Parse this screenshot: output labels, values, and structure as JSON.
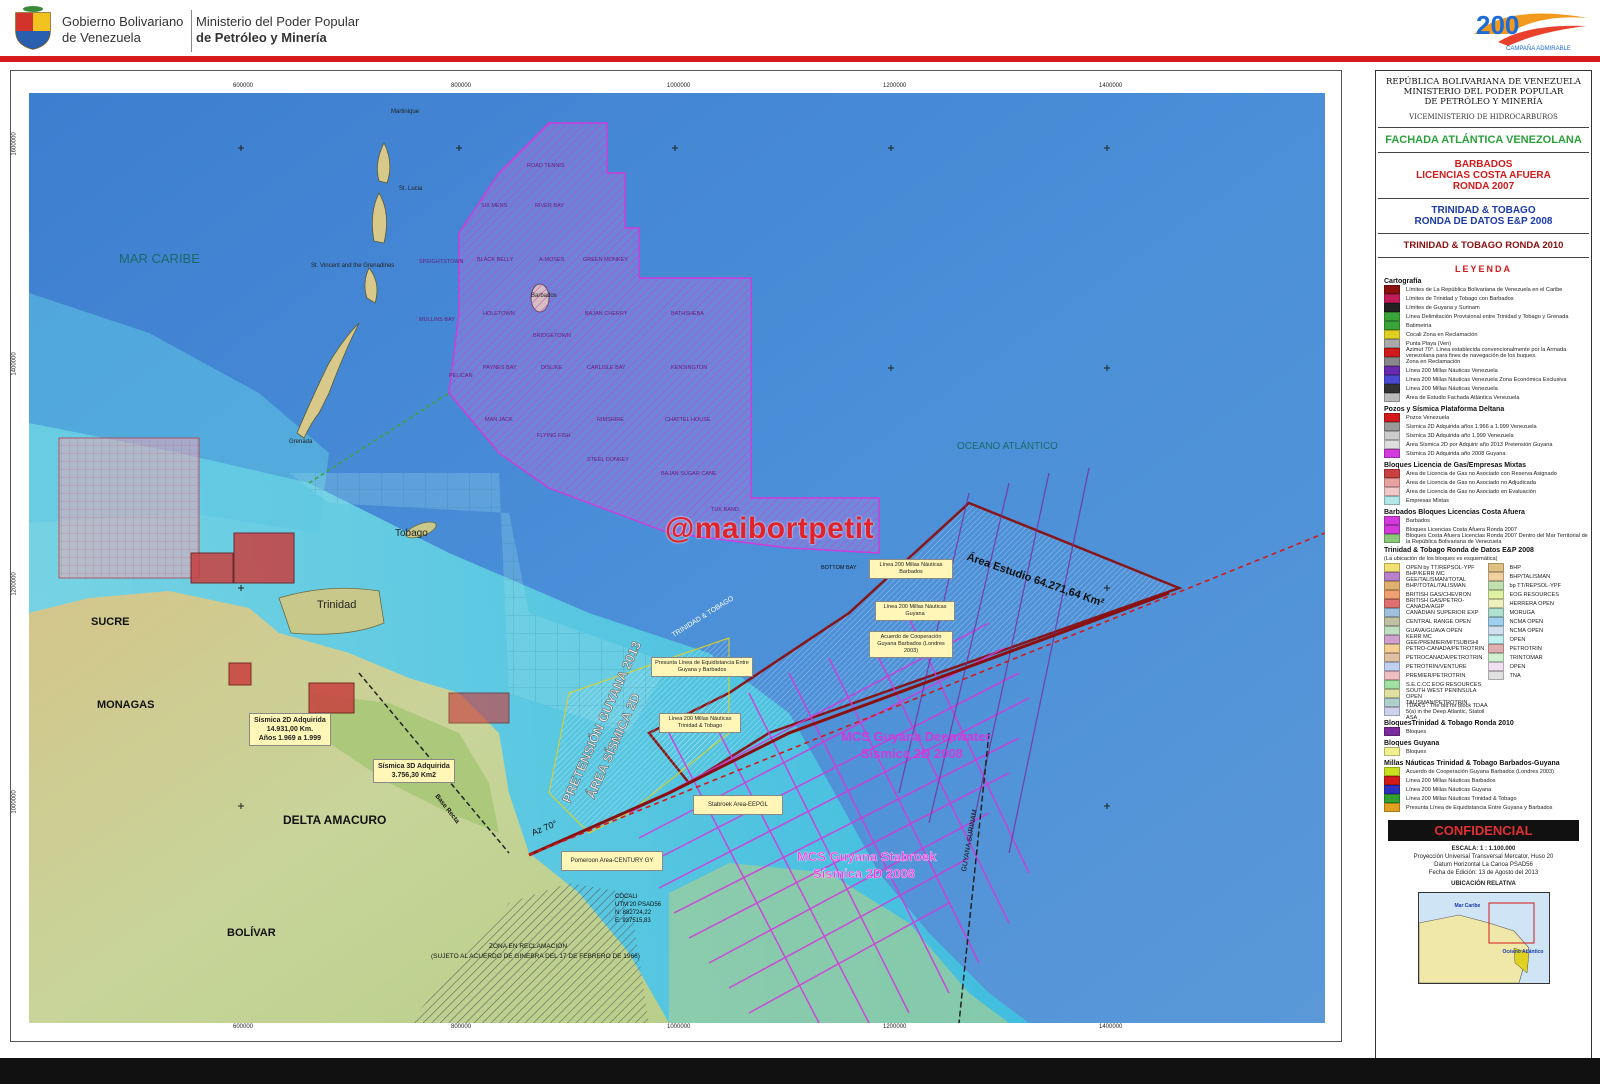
{
  "header": {
    "gov_line1": "Gobierno Bolivariano",
    "gov_line2": "de Venezuela",
    "min_line1": "Ministerio del Poder Popular",
    "min_line2": "de Petróleo y Minería",
    "campaign_text": "CAMPAÑA ADMIRABLE",
    "logo_number": "200"
  },
  "colors": {
    "header_red": "#d91a1a",
    "sea_blue": "#4a8fd0",
    "shelf_cyan": "#5fd0e0",
    "land": "#c8d49a",
    "magenta_blocks": "#d23adb",
    "eez_red": "#8a1010",
    "watermark_red": "#e0232a"
  },
  "map": {
    "watermark": "@maibortpetit",
    "top_ticks": [
      "600000",
      "800000",
      "1000000",
      "1200000",
      "1400000"
    ],
    "left_ticks": [
      "1600000",
      "1400000",
      "1200000",
      "1000000"
    ],
    "regions": {
      "mar_caribe": "MAR CARIBE",
      "oceano": "OCEANO ATLÁNTICO",
      "sucre": "SUCRE",
      "monagas": "MONAGAS",
      "delta": "DELTA AMACURO",
      "bolivar": "BOLÍVAR",
      "trinidad": "Trinidad",
      "tobago": "Tobago",
      "barbados": "Barbados",
      "martinique": "Martinique",
      "st_lucia": "St. Lucia",
      "st_vincent": "St. Vincent and the Grenadines",
      "grenada": "Grenada"
    },
    "barbados_blocks": [
      "ROAD TENNIS",
      "SIX MENS",
      "RIVER BAY",
      "SPEIGHTSTOWN",
      "BLACK BELLY",
      "A-MOSES",
      "GREEN MONKEY",
      "MULLINS BAY",
      "HOLETOWN",
      "BRIDGETOWN",
      "BAJAN CHERRY",
      "BATHSHEBA",
      "PELICAN",
      "PAYNES BAY",
      "DISLIKE",
      "CARLISLE BAY",
      "KENSINGTON",
      "MAN JACK",
      "FLYING FISH",
      "RIMSHIRE",
      "CHATTEL HOUSE",
      "STEEL DONKEY",
      "BAJAN SUGAR CANE",
      "TUK BAND",
      "BOTTOM BAY"
    ],
    "annotations": {
      "area_estudio": "Área Estudio 64.271,64 Km²",
      "pretension": "PRETENSIÓN GUYANA 2013",
      "area_sismica": "ÁREA SÍSMICA 2D",
      "mcs_deepwater_1": "MCS Guyana Deepwater",
      "mcs_deepwater_2": "Sísmica 2D 2008",
      "mcs_stabroek_1": "MCS Guyana Stabroek",
      "mcs_stabroek_2": "Sísmica 2D 2008",
      "guyana_surinam": "GUYANA SURINAM",
      "base_recta": "Base Recta",
      "zona_reclamacion": "ZONA EN RECLAMACIÓN",
      "sujeto_acuerdo": "(SUJETO AL ACUERDO DE GINEBRA DEL 17 DE FEBRERO DE 1966)",
      "cocali": "COCALI",
      "cocali_utm": "UTM 20 PSAD56",
      "cocali_n": "N: 882724,22",
      "cocali_e": "E: 937515,83",
      "sism2d_1": "Sísmica 2D Adquirida",
      "sism2d_2": "14.931,00 Km.",
      "sism2d_3": "Años 1.969 a 1.999",
      "sism3d_1": "Sísmica 3D Adquirida",
      "sism3d_2": "3.756,30 Km2",
      "box_200_barbados": "Línea 200 Millas Náuticas Barbados",
      "box_200_guyana": "Línea 200 Millas Náuticas Guyana",
      "box_acuerdo": "Acuerdo de Cooperación Guyana Barbados (Londres 2003)",
      "box_presunta": "Presunta Línea de Equidistancia Entre Guyana y Barbados",
      "box_200_tt": "Línea 200 Millas Náuticas Trinidad & Tobago",
      "box_stabroek": "Stabroek Area-EEPGL",
      "box_pomeroon": "Pomeroon Area-CENTURY GY",
      "az70": "Az 70°",
      "trinidad_tobago": "TRINIDAD & TOBAGO",
      "tt_barbados": "TRINIDAD & TOBAGO"
    }
  },
  "legend": {
    "title1": "REPÚBLICA BOLIVARIANA DE VENEZUELA",
    "title2": "MINISTERIO DEL PODER POPULAR",
    "title3": "DE PETRÓLEO Y MINERÍA",
    "vice": "VICEMINISTERIO DE HIDROCARBUROS",
    "fachada": "FACHADA ATLÁNTICA VENEZOLANA",
    "barb1": "BARBADOS",
    "barb2": "LICENCIAS COSTA AFUERA",
    "barb3": "RONDA 2007",
    "tt1": "TRINIDAD & TOBAGO",
    "tt2": "RONDA DE DATOS E&P 2008",
    "tt2010": "TRINIDAD & TOBAGO RONDA 2010",
    "leyenda": "LEYENDA",
    "sec_cartografia": "Cartografía",
    "cartografia": [
      {
        "label": "Límites de La República Bolivariana de Venezuela en el Caribe",
        "color": "#8a1010"
      },
      {
        "label": "Límites de Trinidad y Tobago con Barbados",
        "color": "#c01c5a"
      },
      {
        "label": "Límites de Guyana y Surinam",
        "color": "#222222"
      },
      {
        "label": "Línea Delimitación Provisional entre Trinidad y Tobago y Grenada",
        "color": "#3aa43a"
      },
      {
        "label": "Batimetría",
        "color": "#3aa43a"
      },
      {
        "label": "Cocali Zona en Reclamación",
        "color": "#e0d020"
      },
      {
        "label": "Punta Playa (Ven)",
        "color": "#aaaaaa"
      },
      {
        "label": "Azimut 70°. Línea establecida convencionalmente por la Armada venezolana para fines de navegación de los buques.",
        "color": "#d21a1a"
      },
      {
        "label": "Zona en Reclamación",
        "color": "#888888"
      },
      {
        "label": "Línea 200 Millas Náuticas Venezuela",
        "color": "#6a2ab0"
      },
      {
        "label": "Línea 200 Millas Náuticas Venezuela Zona Económica Exclusiva",
        "color": "#4a4ad0"
      },
      {
        "label": "Línea 200 Millas Náuticas Venezuela",
        "color": "#333333"
      },
      {
        "label": "Área de Estudio Fachada Atlántica Venezuela",
        "color": "#bbbbbb"
      }
    ],
    "sec_pozos": "Pozos y Sísmica Plataforma Deltana",
    "pozos": [
      {
        "label": "Pozos Venezuela",
        "color": "#d21a1a"
      },
      {
        "label": "Sísmica 2D Adquirida años 1.966 a 1.999 Venezuela",
        "color": "#999999"
      },
      {
        "label": "Sísmica 3D Adquirida año 1.999 Venezuela",
        "color": "#cccccc"
      },
      {
        "label": "Área Sísmica 2D por Adquirir año 2013 Pretensión Guyana",
        "color": "#dddddd"
      },
      {
        "label": "Sísmica 2D Adquirida año 2008 Guyana",
        "color": "#d23adb"
      }
    ],
    "sec_bloques": "Bloques Licencia de Gas/Empresas Mixtas",
    "bloques": [
      {
        "label": "Área de Licencia de Gas no Asociado con Reserva Asignado",
        "color": "#c84040"
      },
      {
        "label": "Área de Licencia de Gas no Asociado no Adjudicada",
        "color": "#e8a0a0"
      },
      {
        "label": "Área de Licencia de Gas no Asociado en Evaluación",
        "color": "#f0c8c8"
      },
      {
        "label": "Empresas Mixtas",
        "color": "#b0e8e8"
      }
    ],
    "sec_barbados": "Barbados Bloques Licencias Costa Afuera",
    "barbados": [
      {
        "label": "Barbados",
        "color": "#d23adb"
      },
      {
        "label": "Bloques Licencias Costa Afuera Ronda 2007",
        "color": "#d23adb"
      },
      {
        "label": "Bloques Costa Afuera Licencias Ronda 2007 Dentro del Mar Territorial de la República Bolivariana de Venezuela",
        "color": "#8ac87a"
      }
    ],
    "sec_tt": "Trinidad & Tobago Ronda de Datos E&P 2008",
    "tt_note": "(La ubicación de los bloques es esquemática)",
    "tt_left": [
      {
        "label": "OPEN by TT/REPSOL-YPF",
        "color": "#f0e070"
      },
      {
        "label": "BHP/KERR MC GEE/TALISMAN/TOTAL",
        "color": "#b880c8"
      },
      {
        "label": "BHP/TOTAL/TALISMAN",
        "color": "#e0b070"
      },
      {
        "label": "BRITISH GAS/CHEVRON",
        "color": "#f0a070"
      },
      {
        "label": "BRITISH GAS/PETRO-CANADA/AGIP",
        "color": "#e07070"
      },
      {
        "label": "CANADIAN SUPERIOR EXP",
        "color": "#a0c0e0"
      },
      {
        "label": "CENTRAL RANGE OPEN",
        "color": "#c0c0a0"
      },
      {
        "label": "GUAVA/GUAVA OPEN",
        "color": "#c0e0c0"
      },
      {
        "label": "KERR MC GEE/PREMIER/MITSUBISHI",
        "color": "#d0a0d0"
      },
      {
        "label": "PETRO-CANADA/PETROTRIN",
        "color": "#f0d090"
      },
      {
        "label": "PETROCANADA/PETROTRIN",
        "color": "#e0c0a0"
      },
      {
        "label": "PETROTRIN/VENTURE",
        "color": "#c0d0f0"
      },
      {
        "label": "PREMIER/PETROTRIN",
        "color": "#f0c0c0"
      },
      {
        "label": "S.E.C.CC EOG RESOURCES",
        "color": "#a0e0a0"
      },
      {
        "label": "SOUTH WEST PENINSULA OPEN",
        "color": "#e0e0a0"
      },
      {
        "label": "TALISMAN/PETROTRIN",
        "color": "#b0d0d0"
      },
      {
        "label": "TDAA 5 : The bid for block TDAA 5(a) in the Deep Atlantic, Statoil ASA",
        "color": "#d0d0f0"
      }
    ],
    "tt_right": [
      {
        "label": "BHP",
        "color": "#e0c080"
      },
      {
        "label": "BHP/TALISMAN",
        "color": "#f0d0a0"
      },
      {
        "label": "bp TT/REPSOL-YPF",
        "color": "#c0e0b0"
      },
      {
        "label": "EOG RESOURCES",
        "color": "#e0f0a0"
      },
      {
        "label": "HERRERA OPEN",
        "color": "#f0f0c0"
      },
      {
        "label": "MORUGA",
        "color": "#b0e0d0"
      },
      {
        "label": "NCMA OPEN",
        "color": "#a0d0f0"
      },
      {
        "label": "NCMA OPEN",
        "color": "#d0e0f0"
      },
      {
        "label": "OPEN",
        "color": "#c0f0f0"
      },
      {
        "label": "PETROTRIN",
        "color": "#e0b0b0"
      },
      {
        "label": "TRINTOMAR",
        "color": "#d0f0d0"
      },
      {
        "label": "OPEN",
        "color": "#f0e0f0"
      },
      {
        "label": "TNA",
        "color": "#e0e0e0"
      }
    ],
    "sec_tt2010": "BloquesTrinidad & Tobago Ronda 2010",
    "tt2010_row": {
      "label": "Bloques",
      "color": "#7a2a9a"
    },
    "sec_guyana": "Bloques Guyana",
    "guyana_row": {
      "label": "Bloques",
      "color": "#f0f090"
    },
    "sec_millas": "Millas Náuticas Trinidad & Tobago Barbados-Guyana",
    "millas": [
      {
        "label": "Acuerdo de Cooperación Guyana Barbados (Londres 2003)",
        "color": "#c8e020"
      },
      {
        "label": "Línea 200 Millas Náuticas Barbados",
        "color": "#d21a1a"
      },
      {
        "label": "Línea 200 Millas Náuticas Guyana",
        "color": "#3030c0"
      },
      {
        "label": "Línea 200 Millas Náuticas Trinidad & Tobago",
        "color": "#30a030"
      },
      {
        "label": "Presunta Línea de Equidistancia Entre Guyana y Barbados",
        "color": "#e0a020"
      }
    ],
    "confidencial": "CONFIDENCIAL",
    "escala": "ESCALA: 1 : 1.100.000",
    "proj1": "Proyección Universal Transversal Mercator, Huso 20",
    "proj2": "Datum Horizontal La Canoa PSAD56",
    "fecha": "Fecha de Edición: 13 de Agosto del 2013",
    "ubicacion": "UBICACIÓN RELATIVA",
    "inset_labels": [
      "Mar Caribe",
      "Océano Atlántico"
    ]
  }
}
